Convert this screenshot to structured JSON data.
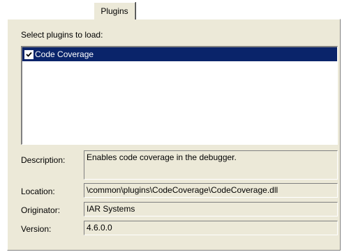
{
  "tab": {
    "label": "Plugins"
  },
  "list": {
    "label": "Select plugins to load:",
    "items": [
      {
        "label": "Code Coverage",
        "checked": true,
        "selected": true
      }
    ]
  },
  "details": {
    "description_label": "Description:",
    "description_value": "Enables code coverage in the debugger.",
    "location_label": "Location:",
    "location_value": "\\common\\plugins\\CodeCoverage\\CodeCoverage.dll",
    "originator_label": "Originator:",
    "originator_value": "IAR Systems",
    "version_label": "Version:",
    "version_value": "4.6.0.0"
  },
  "colors": {
    "dialog_bg": "#ece9d8",
    "selection_bg": "#0a246a",
    "selection_text": "#ffffff"
  }
}
